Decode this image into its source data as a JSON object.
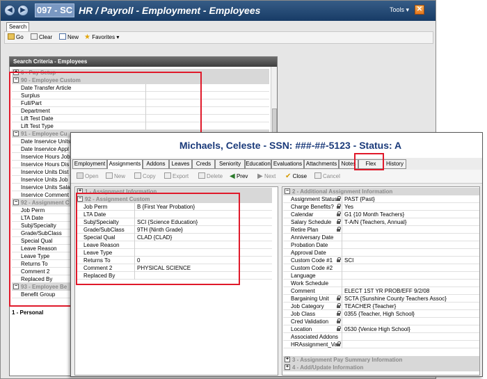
{
  "app": {
    "code": "097 - SC",
    "title": "HR / Payroll - Employment - Employees",
    "tools_label": "Tools",
    "tab": "Search"
  },
  "toolbar": {
    "go": "Go",
    "clear": "Clear",
    "new": "New",
    "favorites": "Favorites"
  },
  "search_panel": {
    "header": "Search Criteria - Employees",
    "sections": [
      {
        "label": "6 - Pay Setup",
        "expanded": false,
        "fields": []
      },
      {
        "label": "90 - Employee Custom",
        "expanded": true,
        "fields": [
          "Date Transfer Article",
          "Surplus",
          "Full/Part",
          "Department",
          "Lift Test Date",
          "Lift Test Type"
        ]
      },
      {
        "label": "91 - Employee Cu",
        "expanded": true,
        "fields": [
          "Date Inservice Units Appl",
          "Date Inservice Appl",
          "Inservice Hours Job",
          "Inservice Hours Dis",
          "Inservice Units Dist",
          "Inservice Units Job",
          "Inservice Units Sala",
          "Inservice Comment"
        ]
      },
      {
        "label": "92 - Assignment C",
        "expanded": true,
        "fields": [
          "Job Perm",
          "LTA Date",
          "Subj/Specialty",
          "Grade/SubClass",
          "Special Qual",
          "Leave Reason",
          "Leave Type",
          "Returns To",
          "Comment 2",
          "Replaced By"
        ]
      },
      {
        "label": "93 - Employee Be",
        "expanded": true,
        "fields": [
          "Benefit Group"
        ]
      }
    ],
    "footer": "1 - Personal"
  },
  "detail": {
    "title": "Michaels, Celeste - SSN: ###-##-5123 - Status: A",
    "tabs": [
      "Employment",
      "Assignments",
      "Addons",
      "Leaves",
      "Creds",
      "Seniority",
      "Education",
      "Evaluations",
      "Attachments",
      "Notes",
      "Flex",
      "History"
    ],
    "active_tab": "Assignments",
    "toolbar": {
      "open": "Open",
      "new": "New",
      "copy": "Copy",
      "export": "Export",
      "delete": "Delete",
      "prev": "Prev",
      "next": "Next",
      "close": "Close",
      "cancel": "Cancel"
    },
    "left": {
      "section1": "1 - Assignment Information",
      "section2": "92 - Assignment Custom",
      "rows": [
        {
          "label": "Job Perm",
          "value": "B {First Year Probation}"
        },
        {
          "label": "LTA Date",
          "value": ""
        },
        {
          "label": "Subj/Specialty",
          "value": "SCI {Science Education}"
        },
        {
          "label": "Grade/SubClass",
          "value": "9TH {Ninth Grade}"
        },
        {
          "label": "Special Qual",
          "value": "CLAD {CLAD}"
        },
        {
          "label": "Leave Reason",
          "value": ""
        },
        {
          "label": "Leave Type",
          "value": ""
        },
        {
          "label": "Returns To",
          "value": "0"
        },
        {
          "label": "Comment 2",
          "value": "PHYSICAL SCIENCE"
        },
        {
          "label": "Replaced By",
          "value": ""
        }
      ]
    },
    "right": {
      "section1": "2 - Additional Assignment Information",
      "rows": [
        {
          "label": "Assignment Status",
          "value": "PAST {Past}",
          "locked": true
        },
        {
          "label": "Charge Benefits?",
          "value": "Yes",
          "locked": true
        },
        {
          "label": "Calendar",
          "value": "G1 {10 Month Teachers}",
          "locked": true
        },
        {
          "label": "Salary Schedule",
          "value": "T-A/N {Teachers, Annual}",
          "locked": true
        },
        {
          "label": "Retire Plan",
          "value": "",
          "locked": true
        },
        {
          "label": "Anniversary Date",
          "value": "",
          "locked": false
        },
        {
          "label": "Probation Date",
          "value": "",
          "locked": false
        },
        {
          "label": "Approval Date",
          "value": "",
          "locked": false
        },
        {
          "label": "Custom Code #1",
          "value": "SCI",
          "locked": true
        },
        {
          "label": "Custom Code #2",
          "value": "",
          "locked": false
        },
        {
          "label": "Language",
          "value": "",
          "locked": false
        },
        {
          "label": "Work Schedule",
          "value": "",
          "locked": false
        },
        {
          "label": "Comment",
          "value": "ELECT 1ST YR PROB/EFF 9/2/08",
          "locked": false
        },
        {
          "label": "Bargaining Unit",
          "value": "SCTA {Sunshine County Teachers Assoc}",
          "locked": true
        },
        {
          "label": "Job Category",
          "value": "TEACHER {Teacher}",
          "locked": true
        },
        {
          "label": "Job Class",
          "value": "0355 {Teacher, High School}",
          "locked": true
        },
        {
          "label": "Cred Validation",
          "value": "",
          "locked": true
        },
        {
          "label": "Location",
          "value": "0530 {Venice High School}",
          "locked": true
        },
        {
          "label": "Associated Addons",
          "value": "",
          "locked": false
        },
        {
          "label": "HRAssignment_Va",
          "value": "",
          "locked": true
        }
      ],
      "section3": "3 - Assignment Pay Summary Information",
      "section4": "4 - Add/Update Information"
    }
  },
  "colors": {
    "title_bar": "#234a77",
    "highlight": "#e0192a",
    "detail_title": "#1a3a7a"
  }
}
